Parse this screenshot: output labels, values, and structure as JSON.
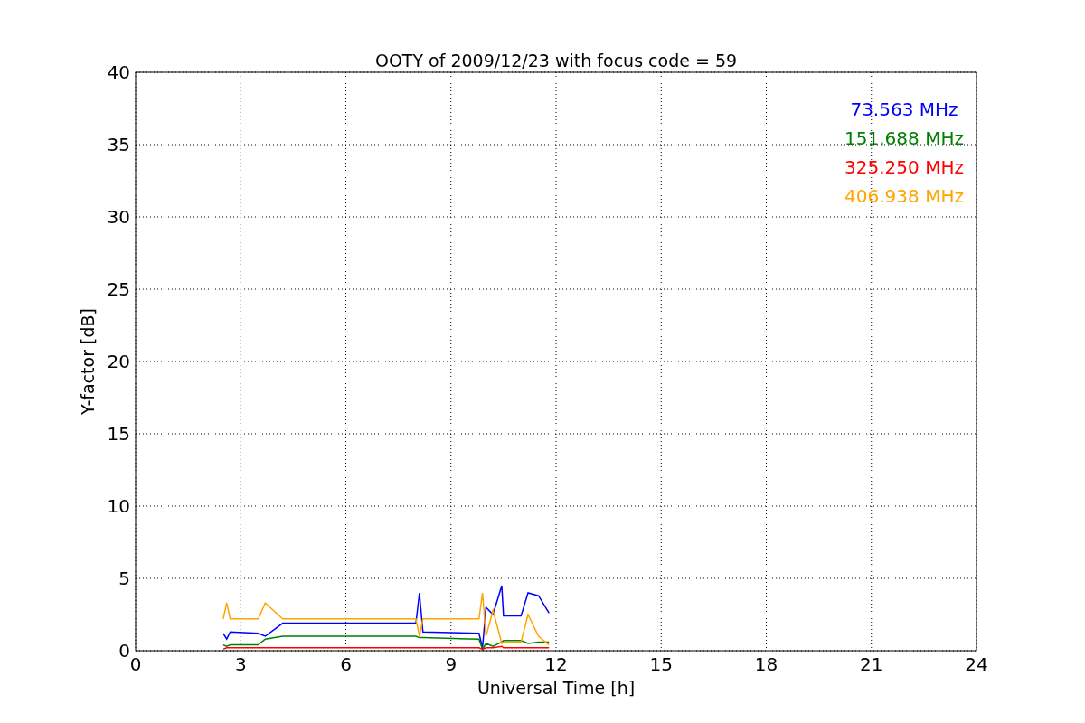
{
  "chart_data": {
    "type": "line",
    "title": "OOTY of 2009/12/23 with focus code = 59",
    "xlabel": "Universal Time [h]",
    "ylabel": "Y-factor [dB]",
    "x": [
      2.5,
      2.6,
      2.7,
      3.5,
      3.7,
      4.2,
      8.0,
      8.1,
      8.2,
      9.8,
      9.9,
      10.0,
      10.2,
      10.45,
      10.5,
      11.0,
      11.2,
      11.5,
      11.8
    ],
    "series": [
      {
        "name": "73.563 MHz",
        "color": "#0000ff",
        "values": [
          1.2,
          0.8,
          1.3,
          1.2,
          1.0,
          1.9,
          1.9,
          4.0,
          1.3,
          1.2,
          0.2,
          3.0,
          2.5,
          4.5,
          2.4,
          2.4,
          4.0,
          3.8,
          2.6
        ]
      },
      {
        "name": "151.688 MHz",
        "color": "#008000",
        "values": [
          0.4,
          0.3,
          0.4,
          0.4,
          0.8,
          1.0,
          1.0,
          0.9,
          0.9,
          0.8,
          0.1,
          0.5,
          0.3,
          0.6,
          0.7,
          0.7,
          0.5,
          0.6,
          0.6
        ]
      },
      {
        "name": "325.250 MHz",
        "color": "#ff0000",
        "values": [
          0.1,
          0.2,
          0.2,
          0.2,
          0.2,
          0.2,
          0.2,
          0.2,
          0.2,
          0.2,
          0.1,
          0.2,
          0.2,
          0.3,
          0.2,
          0.2,
          0.2,
          0.2,
          0.2
        ]
      },
      {
        "name": "406.938 MHz",
        "color": "#ffa500",
        "values": [
          2.2,
          3.3,
          2.2,
          2.2,
          3.3,
          2.2,
          2.2,
          1.0,
          2.2,
          2.2,
          4.0,
          1.0,
          2.8,
          0.5,
          0.6,
          0.6,
          2.5,
          1.0,
          0.4
        ]
      }
    ],
    "xlim": [
      0,
      24
    ],
    "ylim": [
      0,
      40
    ],
    "xticks": [
      0,
      3,
      6,
      9,
      12,
      15,
      18,
      21,
      24
    ],
    "yticks": [
      0,
      5,
      10,
      15,
      20,
      25,
      30,
      35,
      40
    ],
    "grid": true
  }
}
